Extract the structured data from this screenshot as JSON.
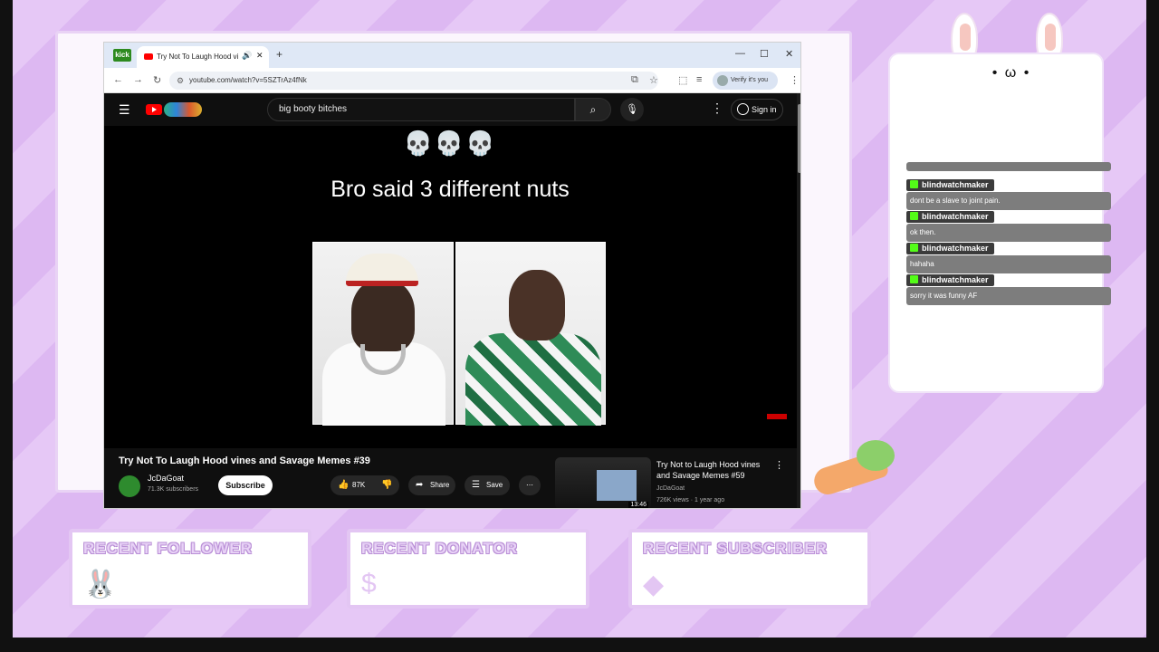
{
  "browser": {
    "extension_badge": "kick",
    "tab_title": "Try Not To Laugh Hood vines",
    "url": "youtube.com/watch?v=5SZTrAz4fNk",
    "profile_label": "Verify it's you"
  },
  "youtube": {
    "search_value": "big booty bitches",
    "signin_label": "Sign in",
    "video": {
      "emoji": "💀💀💀",
      "caption": "Bro said 3 different nuts"
    },
    "title": "Try Not To Laugh Hood vines and Savage Memes #39",
    "channel": "JcDaGoat",
    "subscribers": "71.3K subscribers",
    "subscribe_label": "Subscribe",
    "likes": "87K",
    "share_label": "Share",
    "save_label": "Save",
    "recommended": {
      "title": "Try Not to Laugh Hood vines and Savage Memes #59",
      "channel": "JcDaGoat",
      "meta": "726K views · 1 year ago",
      "duration": "13:46"
    }
  },
  "chat": {
    "messages": [
      {
        "user": "blindwatchmaker",
        "text": "dont be a slave to joint pain."
      },
      {
        "user": "blindwatchmaker",
        "text": "ok then."
      },
      {
        "user": "blindwatchmaker",
        "text": "hahaha"
      },
      {
        "user": "blindwatchmaker",
        "text": "sorry it was funny AF"
      }
    ]
  },
  "widgets": {
    "follower": "RECENT FOLLOWER",
    "donator": "RECENT DONATOR",
    "subscriber": "RECENT SUBSCRIBER",
    "donator_icon": "$"
  }
}
